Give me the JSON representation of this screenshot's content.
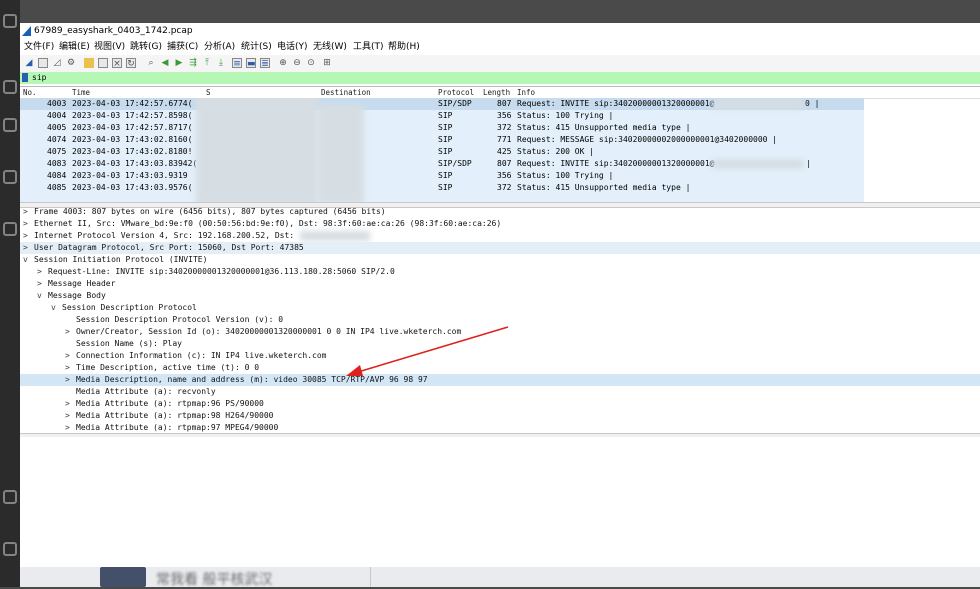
{
  "window": {
    "title": "67989_easyshark_0403_1742.pcap"
  },
  "menu": [
    "文件(F)",
    "编辑(E)",
    "视图(V)",
    "跳转(G)",
    "捕获(C)",
    "分析(A)",
    "统计(S)",
    "电话(Y)",
    "无线(W)",
    "工具(T)",
    "帮助(H)"
  ],
  "filter": {
    "value": "sip"
  },
  "columns": {
    "no": "No.",
    "time": "Time",
    "source": "S",
    "destination": "Destination",
    "protocol": "Protocol",
    "length": "Length",
    "info": "Info"
  },
  "packets": [
    {
      "no": "4003",
      "time": "2023-04-03 17:42:57.6774(",
      "proto": "SIP/SDP",
      "len": "807",
      "info": "Request: INVITE sip:34020000001320000001@",
      "tail": "0 |"
    },
    {
      "no": "4004",
      "time": "2023-04-03 17:42:57.8598(",
      "proto": "SIP",
      "len": "356",
      "info": "Status: 100 Trying |",
      "tail": ""
    },
    {
      "no": "4005",
      "time": "2023-04-03 17:42:57.8717(",
      "proto": "SIP",
      "len": "372",
      "info": "Status: 415 Unsupported media type |",
      "tail": ""
    },
    {
      "no": "4074",
      "time": "2023-04-03 17:43:02.8160(",
      "proto": "SIP",
      "len": "771",
      "info": "Request: MESSAGE sip:34020000002000000001@3402000000 |",
      "tail": ""
    },
    {
      "no": "4075",
      "time": "2023-04-03 17:43:02.8180!",
      "proto": "SIP",
      "len": "425",
      "info": "Status: 200 OK |",
      "tail": ""
    },
    {
      "no": "4083",
      "time": "2023-04-03 17:43:03.83942(",
      "proto": "SIP/SDP",
      "len": "807",
      "info": "Request: INVITE sip:34020000001320000001@",
      "tail": "|"
    },
    {
      "no": "4084",
      "time": "2023-04-03 17:43:03.9319",
      "proto": "SIP",
      "len": "356",
      "info": "Status: 100 Trying |",
      "tail": ""
    },
    {
      "no": "4085",
      "time": "2023-04-03 17:43:03.9576(",
      "proto": "SIP",
      "len": "372",
      "info": "Status: 415 Unsupported media type |",
      "tail": ""
    }
  ],
  "details": [
    {
      "indent": 0,
      "exp": ">",
      "text": "Frame 4003: 807 bytes on wire (6456 bits), 807 bytes captured (6456 bits)",
      "hl": ""
    },
    {
      "indent": 0,
      "exp": ">",
      "text": "Ethernet II, Src: VMware_bd:9e:f0 (00:50:56:bd:9e:f0), Dst: 98:3f:60:ae:ca:26 (98:3f:60:ae:ca:26)",
      "hl": ""
    },
    {
      "indent": 0,
      "exp": ">",
      "text": "Internet Protocol Version 4, Src: 192.168.200.52, Dst:",
      "hl": ""
    },
    {
      "indent": 0,
      "exp": ">",
      "text": "User Datagram Protocol, Src Port: 15060, Dst Port: 47385",
      "hl": "hl2"
    },
    {
      "indent": 0,
      "exp": "v",
      "text": "Session Initiation Protocol (INVITE)",
      "hl": ""
    },
    {
      "indent": 1,
      "exp": ">",
      "text": "Request-Line: INVITE sip:34020000001320000001@36.113.180.28:5060 SIP/2.0",
      "hl": ""
    },
    {
      "indent": 1,
      "exp": ">",
      "text": "Message Header",
      "hl": ""
    },
    {
      "indent": 1,
      "exp": "v",
      "text": "Message Body",
      "hl": ""
    },
    {
      "indent": 2,
      "exp": "v",
      "text": "Session Description Protocol",
      "hl": ""
    },
    {
      "indent": 3,
      "exp": "",
      "text": "Session Description Protocol Version (v): 0",
      "hl": ""
    },
    {
      "indent": 3,
      "exp": ">",
      "text": "Owner/Creator, Session Id (o): 34020000001320000001 0 0 IN IP4 live.wketerch.com",
      "hl": ""
    },
    {
      "indent": 3,
      "exp": "",
      "text": "Session Name (s): Play",
      "hl": ""
    },
    {
      "indent": 3,
      "exp": ">",
      "text": "Connection Information (c): IN IP4 live.wketerch.com",
      "hl": ""
    },
    {
      "indent": 3,
      "exp": ">",
      "text": "Time Description, active time (t): 0 0",
      "hl": ""
    },
    {
      "indent": 3,
      "exp": ">",
      "text": "Media Description, name and address (m): video 30085 TCP/RTP/AVP 96 98 97",
      "hl": "hl"
    },
    {
      "indent": 3,
      "exp": "",
      "text": "Media Attribute (a): recvonly",
      "hl": ""
    },
    {
      "indent": 3,
      "exp": ">",
      "text": "Media Attribute (a): rtpmap:96 PS/90000",
      "hl": ""
    },
    {
      "indent": 3,
      "exp": ">",
      "text": "Media Attribute (a): rtpmap:98 H264/90000",
      "hl": ""
    },
    {
      "indent": 3,
      "exp": ">",
      "text": "Media Attribute (a): rtpmap:97 MPEG4/90000",
      "hl": ""
    }
  ],
  "taskbar": {
    "text": "常我看 般平核武汉"
  },
  "colors": {
    "filter_bg": "#b6f7b6",
    "row_bg": "#e3f0fb",
    "selected_row": "#c6dcee",
    "arrow": "#e0201c"
  }
}
